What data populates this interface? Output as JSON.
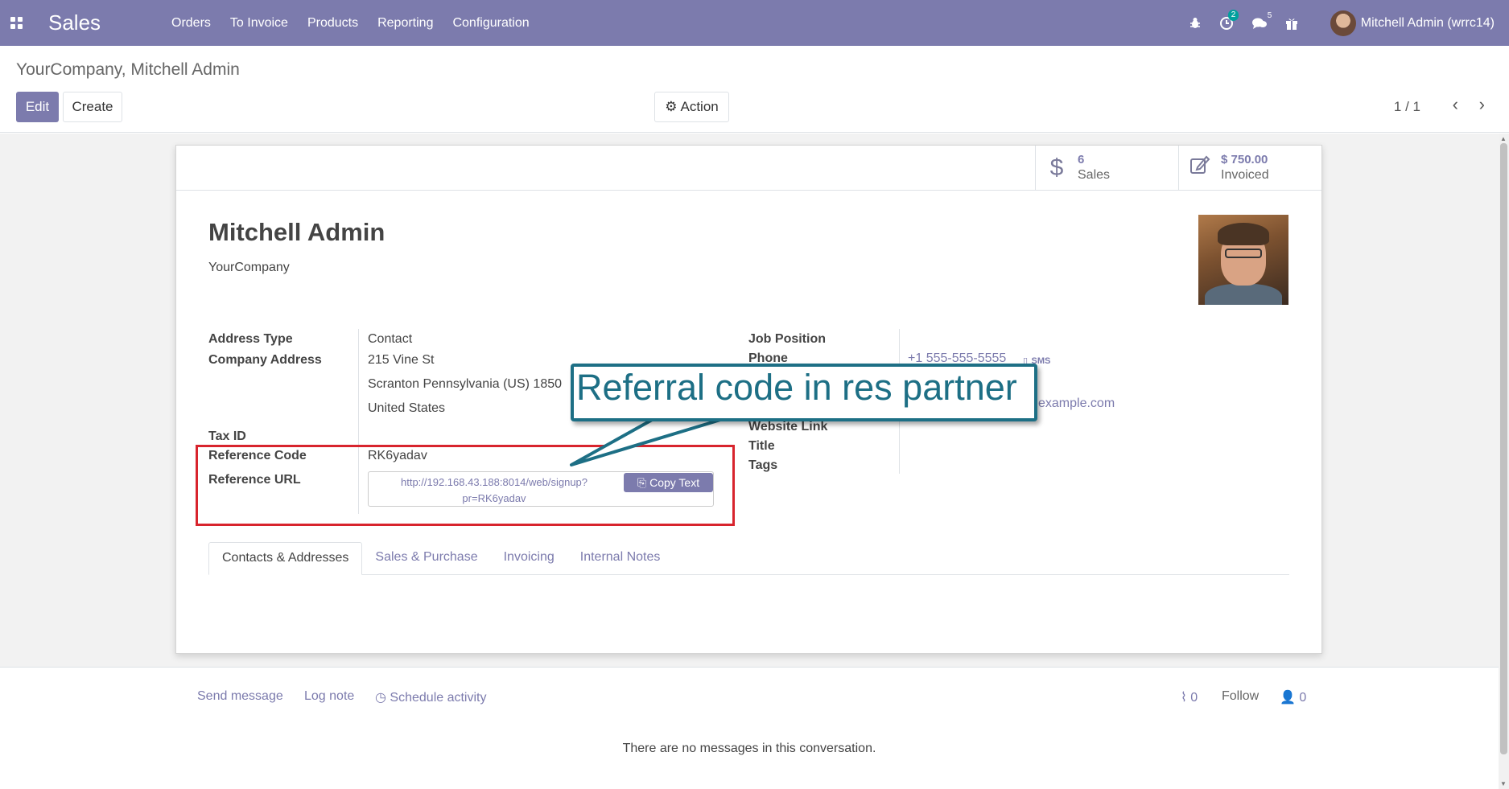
{
  "navbar": {
    "brand": "Sales",
    "menu": [
      "Orders",
      "To Invoice",
      "Products",
      "Reporting",
      "Configuration"
    ],
    "activity_count": "2",
    "message_count": "5",
    "user": "Mitchell Admin (wrrc14)"
  },
  "control_panel": {
    "breadcrumb": "YourCompany, Mitchell Admin",
    "edit_label": "Edit",
    "create_label": "Create",
    "action_label": "Action",
    "pager": "1 / 1"
  },
  "stat_buttons": {
    "sales_value": "6",
    "sales_label": "Sales",
    "invoiced_value": "$ 750.00",
    "invoiced_label": "Invoiced"
  },
  "partner": {
    "name": "Mitchell Admin",
    "company": "YourCompany"
  },
  "left_fields": {
    "address_type_label": "Address Type",
    "address_type_value": "Contact",
    "company_address_label": "Company Address",
    "street": "215 Vine St",
    "city_line": "Scranton  Pennsylvania (US)  1850",
    "country": "United States",
    "tax_id_label": "Tax ID",
    "ref_code_label": "Reference Code",
    "ref_code_value": "RK6yadav",
    "ref_url_label": "Reference URL",
    "ref_url_line1": "http://192.168.43.188:8014/web/signup?",
    "ref_url_line2": "pr=RK6yadav",
    "copy_label": "Copy Text"
  },
  "right_fields": {
    "job_position_label": "Job Position",
    "phone_label": "Phone",
    "phone_value": "+1 555-555-5555",
    "sms_label": "SMS",
    "email_value": "example.com",
    "website_label": "Website Link",
    "title_label": "Title",
    "tags_label": "Tags"
  },
  "callout": {
    "text": "Referral code in res partner"
  },
  "tabs": [
    "Contacts & Addresses",
    "Sales & Purchase",
    "Invoicing",
    "Internal Notes"
  ],
  "chatter": {
    "send_message": "Send message",
    "log_note": "Log note",
    "schedule_activity": "Schedule activity",
    "attachments_count": "0",
    "follow": "Follow",
    "followers_count": "0",
    "empty_text": "There are no messages in this conversation."
  },
  "colors": {
    "brand": "#7c7bad",
    "highlight": "#d8242d",
    "callout": "#1d6f85"
  }
}
